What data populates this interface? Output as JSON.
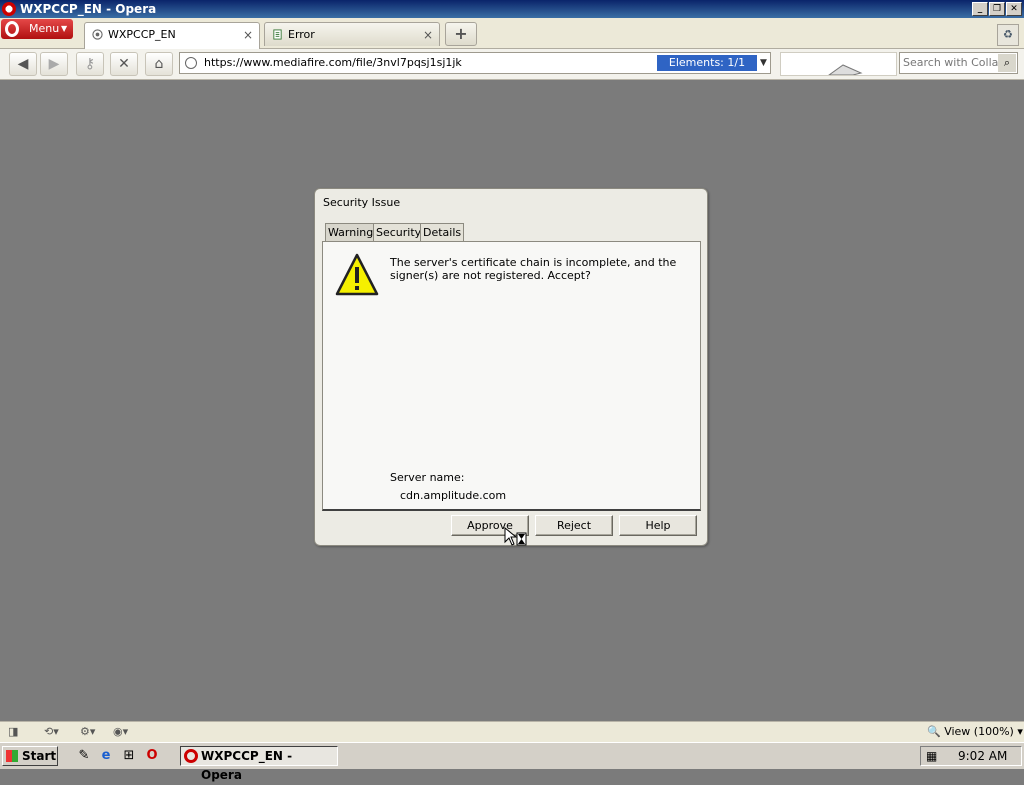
{
  "window": {
    "title": "WXPCCP_EN - Opera",
    "controls": [
      "minimize",
      "restore",
      "close"
    ]
  },
  "tabs": {
    "menu_label": "Menu",
    "items": [
      {
        "label": "WXPCCP_EN",
        "close": "×",
        "active": true
      },
      {
        "label": "Error",
        "close": "×",
        "active": false
      }
    ],
    "new_tab": "+"
  },
  "navbar": {
    "back": "back-icon",
    "forward": "forward-icon",
    "key": "key-icon",
    "stop": "stop-icon",
    "home": "home-icon",
    "url": "https://www.mediafire.com/file/3nvl7pqsj1sj1jk",
    "elements_badge": "Elements:  1/1",
    "search_placeholder": "Search with Collab'"
  },
  "dialog": {
    "title": "Security Issue",
    "tabs": [
      "Warning",
      "Security",
      "Details"
    ],
    "message": "The server's certificate chain is incomplete, and the signer(s) are not registered. Accept?",
    "server_name_label": "Server name:",
    "server_name_value": "cdn.amplitude.com",
    "buttons": {
      "approve": "Approve",
      "reject": "Reject",
      "help": "Help"
    }
  },
  "statusbar": {
    "zoom": "View (100%)"
  },
  "taskbar": {
    "start": "Start",
    "task_label": "WXPCCP_EN - Opera",
    "clock": "9:02 AM"
  },
  "colors": {
    "accent": "#2f64c4",
    "opera_red": "#cc0000",
    "page_bg": "#7b7b7b"
  }
}
